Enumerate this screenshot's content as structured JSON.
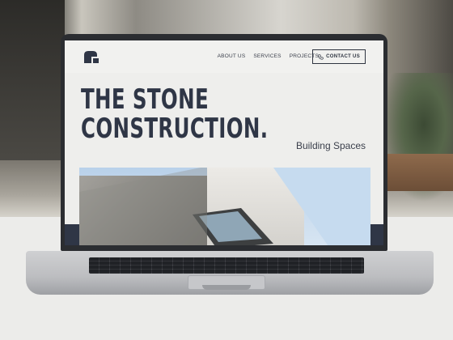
{
  "nav": {
    "links": [
      "ABOUT US",
      "SERVICES",
      "PROJECTS"
    ],
    "contact_label": "CONTACT US",
    "contact_icon": "phone-icon",
    "logo_icon": "stone-logo-icon"
  },
  "hero": {
    "title_line1": "THE STONE",
    "title_line2": "CONSTRUCTION.",
    "subtitle": "Building Spaces"
  },
  "colors": {
    "brand_dark": "#2f3646",
    "page_bg": "#eeeeec"
  }
}
